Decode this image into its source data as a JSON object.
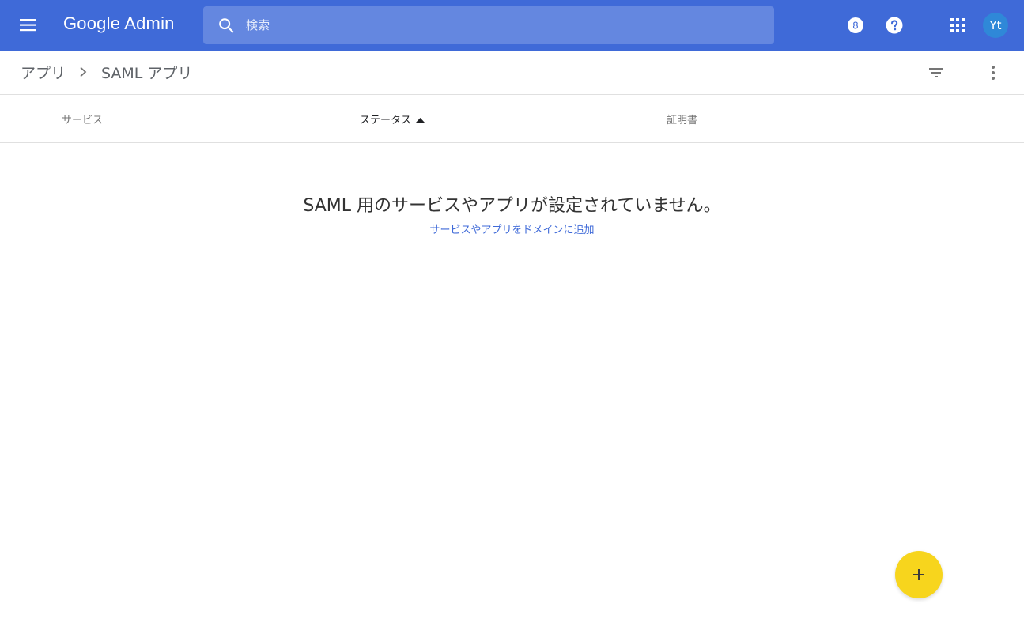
{
  "colors": {
    "appbar": "#3f6ad8",
    "search_bg": "#6487e0",
    "avatar_bg": "#2f88d8",
    "fab": "#f7d51d",
    "link": "#3f6ad8"
  },
  "appbar": {
    "menu_icon": "hamburger-menu-icon",
    "title": "Google Admin",
    "search": {
      "icon": "search-icon",
      "placeholder": "検索",
      "value": ""
    },
    "badge_icon": "admin-badge-icon",
    "badge_text": "8",
    "help_icon": "help-icon",
    "apps_icon": "apps-grid-icon",
    "avatar_initials": "Yt"
  },
  "breadcrumb": {
    "items": [
      "アプリ",
      "SAML アプリ"
    ],
    "separator_icon": "chevron-right-icon",
    "filter_icon": "filter-icon",
    "more_icon": "more-vert-icon"
  },
  "table": {
    "columns": [
      "サービス",
      "ステータス",
      "証明書"
    ],
    "sorted_column": "ステータス",
    "sort_icon": "sort-ascending-icon"
  },
  "empty_state": {
    "message": "SAML 用のサービスやアプリが設定されていません。",
    "link_text": "サービスやアプリをドメインに追加"
  },
  "fab": {
    "icon": "plus-icon"
  }
}
